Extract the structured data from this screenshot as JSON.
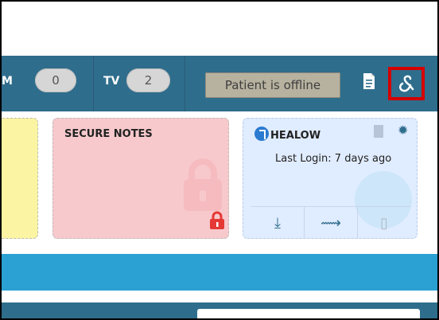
{
  "topbar": {
    "m_label": "M",
    "m_count": "0",
    "tv_label": "TV",
    "tv_count": "2",
    "offline_text": "Patient is offline"
  },
  "cards": {
    "secure_notes": {
      "title": "SECURE NOTES"
    },
    "healow": {
      "title": "HEALOW",
      "last_login": "Last Login: 7 days ago"
    }
  },
  "colors": {
    "topbar": "#2f6d8c",
    "offline_bg": "#b7b29f",
    "highlight": "#d50000",
    "secure_notes_bg": "#f8c9cc",
    "healow_bg": "#e0ecff",
    "band": "#2aa1d2"
  },
  "icons": [
    "note-icon",
    "healow-link-icon",
    "lock-icon",
    "healow-logo-icon",
    "bookmark-icon",
    "gear-icon",
    "download-icon",
    "trend-icon",
    "document-icon"
  ]
}
